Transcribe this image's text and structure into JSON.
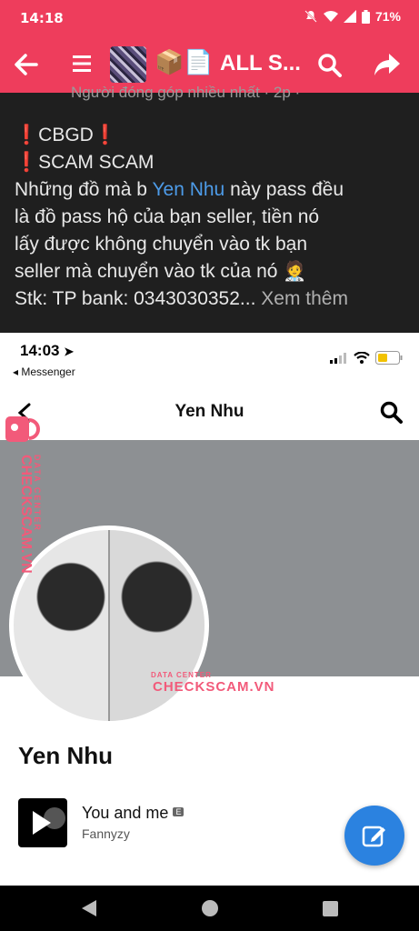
{
  "status_bar": {
    "time": "14:18",
    "battery": "71%"
  },
  "app_bar": {
    "emoji": "📦📄",
    "title": "ALL S..."
  },
  "post": {
    "cut_header": "Người đóng góp nhiều nhất · 2p · ",
    "line1": "CBGD",
    "line2": "SCAM SCAM",
    "line3_pre": "Những đồ mà b ",
    "line3_link": "Yen Nhu",
    "line3_post": " này pass đều",
    "line4": "là đồ pass hộ của bạn seller, tiền nó",
    "line5": "lấy được không chuyển vào tk bạn",
    "line6": "seller mà chuyển vào tk của nó",
    "line7": "Stk: TP bank: 0343030352...",
    "see_more": "Xem thêm"
  },
  "screenshot": {
    "time": "14:03",
    "back_app": "◂ Messenger",
    "header_name": "Yen Nhu",
    "profile_name": "Yen Nhu",
    "song_title": "You and me",
    "song_badge": "E",
    "song_artist": "Fannyzy"
  },
  "watermark": {
    "small": "DATA CENTER",
    "big": "CHECKSCAM.VN"
  },
  "colors": {
    "brand": "#ee3d5c",
    "fab": "#2b82e0",
    "link": "#4d9be8"
  }
}
